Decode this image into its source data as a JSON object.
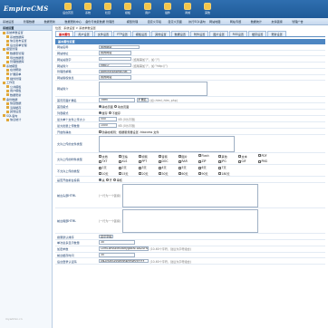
{
  "app": {
    "logo": "EmpireCMS"
  },
  "top_icons": [
    {
      "label": "后台首页"
    },
    {
      "label": "系统"
    },
    {
      "label": "栏目"
    },
    {
      "label": "模板"
    },
    {
      "label": "用户"
    },
    {
      "label": "插件"
    },
    {
      "label": "商城"
    },
    {
      "label": "其他"
    }
  ],
  "nav": [
    "系统设置",
    "管理数据",
    "数据更新",
    "数据更新中心",
    "备份与恢复数据",
    "管理员",
    "模型管理",
    "自定义字段",
    "自定义页面",
    "执行SQL语句",
    "网站地图",
    "网站专题",
    "数据统计",
    "友情链接",
    "管理广告"
  ],
  "sidebar": {
    "title": "系统设置",
    "items": [
      "系统参数设置",
      "系统数据库",
      "信息发布设置",
      "后台菜单管理",
      "模型管理",
      "数据表管理",
      "导出数据表",
      "管理数据库",
      "系统模型",
      "在线帮助",
      "扩展菜单",
      "插件管理",
      "工作流",
      "公共模板",
      "用户模板",
      "数据更新",
      "备份数据",
      "恢复数据",
      "清除缓存",
      "其他设置",
      "SQL语句",
      "信息统计"
    ]
  },
  "watermark": "myadmin.cn",
  "breadcrumb": "位置：系统设置 > 系统参数设置",
  "tabs": [
    "基本属性",
    "用户设置",
    "文件设置",
    "FTP设置",
    "模板设置",
    "其他设置",
    "数据设置",
    "附件设置",
    "图片设置",
    "RSS设置",
    "缓存设置",
    "更新设置"
  ],
  "form": {
    "title": "基本属性设置",
    "rows": [
      {
        "label": "网站名称",
        "value": "我的网站",
        "hint": "",
        "select": ""
      },
      {
        "label": "网站地址",
        "value": "我的网站",
        "hint": "",
        "select": ""
      },
      {
        "label": "网站关键字",
        "value": "/",
        "hint": "(结尾需加\"/\"，如:\"/\")",
        "select": ""
      },
      {
        "label": "网站简介",
        "value": "http://",
        "hint": "(结尾需加\"/\"，如:\"http://\")",
        "select": ""
      },
      {
        "label": "管理员邮箱",
        "value": "admin@phome.net",
        "hint": "",
        "select": ""
      },
      {
        "label": "网站版权信息",
        "value": "我的网站",
        "hint": "",
        "select": ""
      }
    ],
    "desc_label": "网站简介",
    "lang_label": "首页页面扩展名",
    "lang_value": ".html",
    "lang_select": "扩展名",
    "lang_hint": "(如:.html,.htm,.php)",
    "index_mode_label": "首页模式",
    "index_mode_opts": [
      "静态页面",
      "动态页面"
    ],
    "list_mode_label": "列表模式",
    "list_mode_opts": [
      "缓存",
      "不缓存"
    ],
    "count1_label": "最大单个文件上传大小",
    "count1_value": "500",
    "count1_hint": "KB (0为不限)",
    "count2_label": "最大批量上传数量",
    "count2_value": "1000",
    "count2_hint": "KB (0为不限)",
    "rewrite_label": "开启伪静态",
    "rewrite_text": "伪静态规则：根据服务器设置 .htaccess 文件",
    "ext_label": "允许上传的文件类型",
    "ext_value": "",
    "types_label": "允许上传的附件类型",
    "types": [
      "文档",
      "压缩",
      "视频",
      "音频",
      "图片",
      "Flash",
      "其他",
      "文本",
      "PDF",
      "TXT",
      "XLS",
      "PPT",
      "DOC",
      "RAR",
      "ZIP",
      "JPG",
      "GIF",
      "PNG"
    ],
    "days_label": "不允许上传的类型",
    "days": [
      "1天",
      "2天",
      "3天",
      "4天",
      "5天",
      "6天",
      "7天",
      "10天",
      "15天",
      "20天",
      "30天",
      "60天",
      "90天",
      "180天"
    ],
    "fb_label": "是否开启前台投稿",
    "fb_opts": [
      "关",
      "开",
      "审核"
    ],
    "header_label": "前台头部HTML",
    "header_hint": "(一行为一个链接)",
    "footer_label": "前台尾部HTML",
    "footer_hint": "(一行为一个链接)",
    "search_label": "搜索默认排序",
    "search_value": "显示字段",
    "f1_label": "单次最多显示数量",
    "f1_value": "30",
    "f2_label": "加密参数",
    "f2_value": "CkmLBYssxtRSf8RygbENTDoZuFfw8Qz",
    "f2_hint": "(10-60个字符，建议为字符组合)",
    "f3_label": "前台缓存时间",
    "f3_value": "30",
    "f4_label": "后台登录认证码",
    "f4_value": "0N2l9XnGnhdRhRW9hyRHYYYY",
    "f4_hint": "(10-60个字符，建议为字符组合)"
  }
}
